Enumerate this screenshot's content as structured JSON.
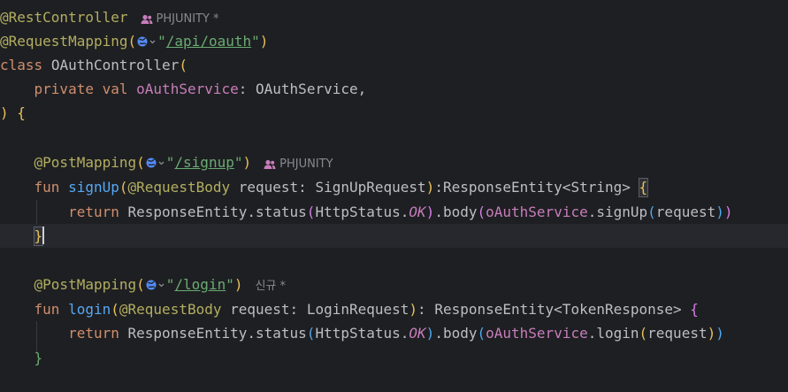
{
  "code": {
    "l1": {
      "annotation": "@RestController",
      "author": "PHJUNITY",
      "modified": "*"
    },
    "l2": {
      "annotation": "@RequestMapping",
      "open": "(",
      "url": "/api/oauth",
      "close": ")"
    },
    "l3": {
      "keyword": "class",
      "name": "OAuthController",
      "open": "("
    },
    "l4": {
      "kw1": "private",
      "kw2": "val",
      "param": "oAuthService",
      "colon": ": ",
      "type": "OAuthService",
      "comma": ","
    },
    "l5": {
      "close": ")",
      "brace": "{"
    },
    "l7": {
      "annotation": "@PostMapping",
      "open": "(",
      "url": "/signup",
      "close": ")",
      "author": "PHJUNITY"
    },
    "l8": {
      "kw": "fun",
      "name": "signUp",
      "open": "(",
      "ann": "@RequestBody",
      "param": " request: SignUpRequest",
      "close": ")",
      "ret": ":ResponseEntity<String> ",
      "brace": "{"
    },
    "l9": {
      "kw": "return",
      "expr1": "ResponseEntity.status",
      "open1": "(",
      "expr2": "HttpStatus.",
      "ok": "OK",
      "close1": ")",
      "expr3": ".body",
      "open2": "(",
      "svc": "oAuthService",
      "call": ".signUp",
      "open3": "(",
      "arg": "request",
      "close3": ")",
      "close2": ")"
    },
    "l10": {
      "brace": "}"
    },
    "l12": {
      "annotation": "@PostMapping",
      "open": "(",
      "url": "/login",
      "close": ")",
      "tag": "신규 *"
    },
    "l13": {
      "kw": "fun",
      "name": "login",
      "open": "(",
      "ann": "@RequestBody",
      "param": " request: LoginRequest",
      "close": ")",
      "ret": ": ResponseEntity<TokenResponse> ",
      "brace": "{"
    },
    "l14": {
      "kw": "return",
      "expr1": "ResponseEntity.status",
      "open1": "(",
      "expr2": "HttpStatus.",
      "ok": "OK",
      "close1": ")",
      "expr3": ".body",
      "open2": "(",
      "svc": "oAuthService",
      "call": ".login",
      "open3": "(",
      "arg": "request",
      "close3": ")",
      "close2": ")"
    },
    "l15": {
      "brace": "}"
    }
  },
  "icons": {
    "globe": "globe-icon",
    "people": "people-icon",
    "chevron": "chevron-down-icon"
  }
}
